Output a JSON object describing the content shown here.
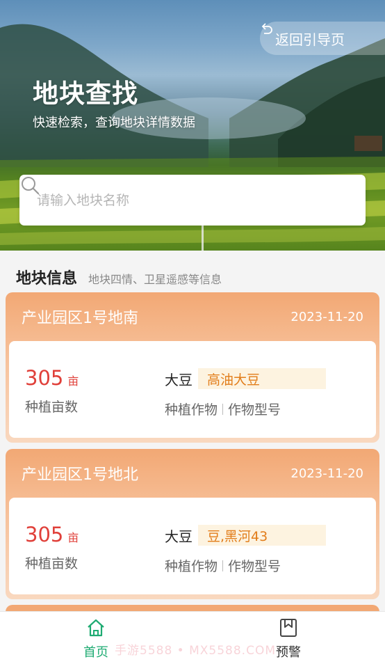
{
  "header": {
    "back_label": "返回引导页",
    "title": "地块查找",
    "subtitle": "快速检索，查询地块详情数据"
  },
  "search": {
    "placeholder": "请输入地块名称",
    "value": ""
  },
  "section": {
    "title": "地块信息",
    "subtitle": "地块四情、卫星遥感等信息"
  },
  "plots": [
    {
      "name": "产业园区1号地南",
      "date": "2023-11-20",
      "area_value": "305",
      "area_unit": "亩",
      "area_label": "种植亩数",
      "crop": "大豆",
      "crop_model": "高油大豆",
      "crop_label": "种植作物",
      "model_label": "作物型号"
    },
    {
      "name": "产业园区1号地北",
      "date": "2023-11-20",
      "area_value": "305",
      "area_unit": "亩",
      "area_label": "种植亩数",
      "crop": "大豆",
      "crop_model": "豆,黑河43",
      "crop_label": "种植作物",
      "model_label": "作物型号"
    }
  ],
  "tabbar": {
    "home_label": "首页",
    "alert_label": "预警"
  },
  "watermark": "手游5588 • MX5588.COM",
  "colors": {
    "accent": "#1eab72",
    "card_header": "#f2a874",
    "value_red": "#e0403a",
    "tag_orange": "#e27d1a",
    "tag_bg": "#fdf3e0"
  },
  "icons": {
    "back": "back-arrow-icon",
    "search": "search-icon",
    "home": "home-icon",
    "alert": "bookmark-icon"
  }
}
